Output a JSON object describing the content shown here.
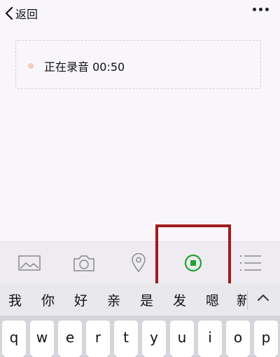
{
  "nav": {
    "back_label": "返回",
    "back_icon": "chevron-left-icon",
    "more_icon": "more-dots-icon"
  },
  "recording": {
    "status_text": "正在录音 00:50",
    "indicator_color": "#f6cdb6"
  },
  "toolbar": {
    "items": [
      {
        "name": "image-icon"
      },
      {
        "name": "camera-icon"
      },
      {
        "name": "location-icon"
      },
      {
        "name": "record-stop-icon",
        "active": true,
        "color": "#23a331"
      },
      {
        "name": "list-icon"
      }
    ],
    "highlight_color": "#a31b1b"
  },
  "suggestions": {
    "candidates": [
      "我",
      "你",
      "好",
      "亲",
      "是",
      "发",
      "嗯",
      "新"
    ],
    "expand_icon": "chevron-up-icon"
  },
  "keyboard": {
    "row1": [
      "q",
      "w",
      "e",
      "r",
      "t",
      "y",
      "u",
      "i",
      "o",
      "p"
    ]
  }
}
